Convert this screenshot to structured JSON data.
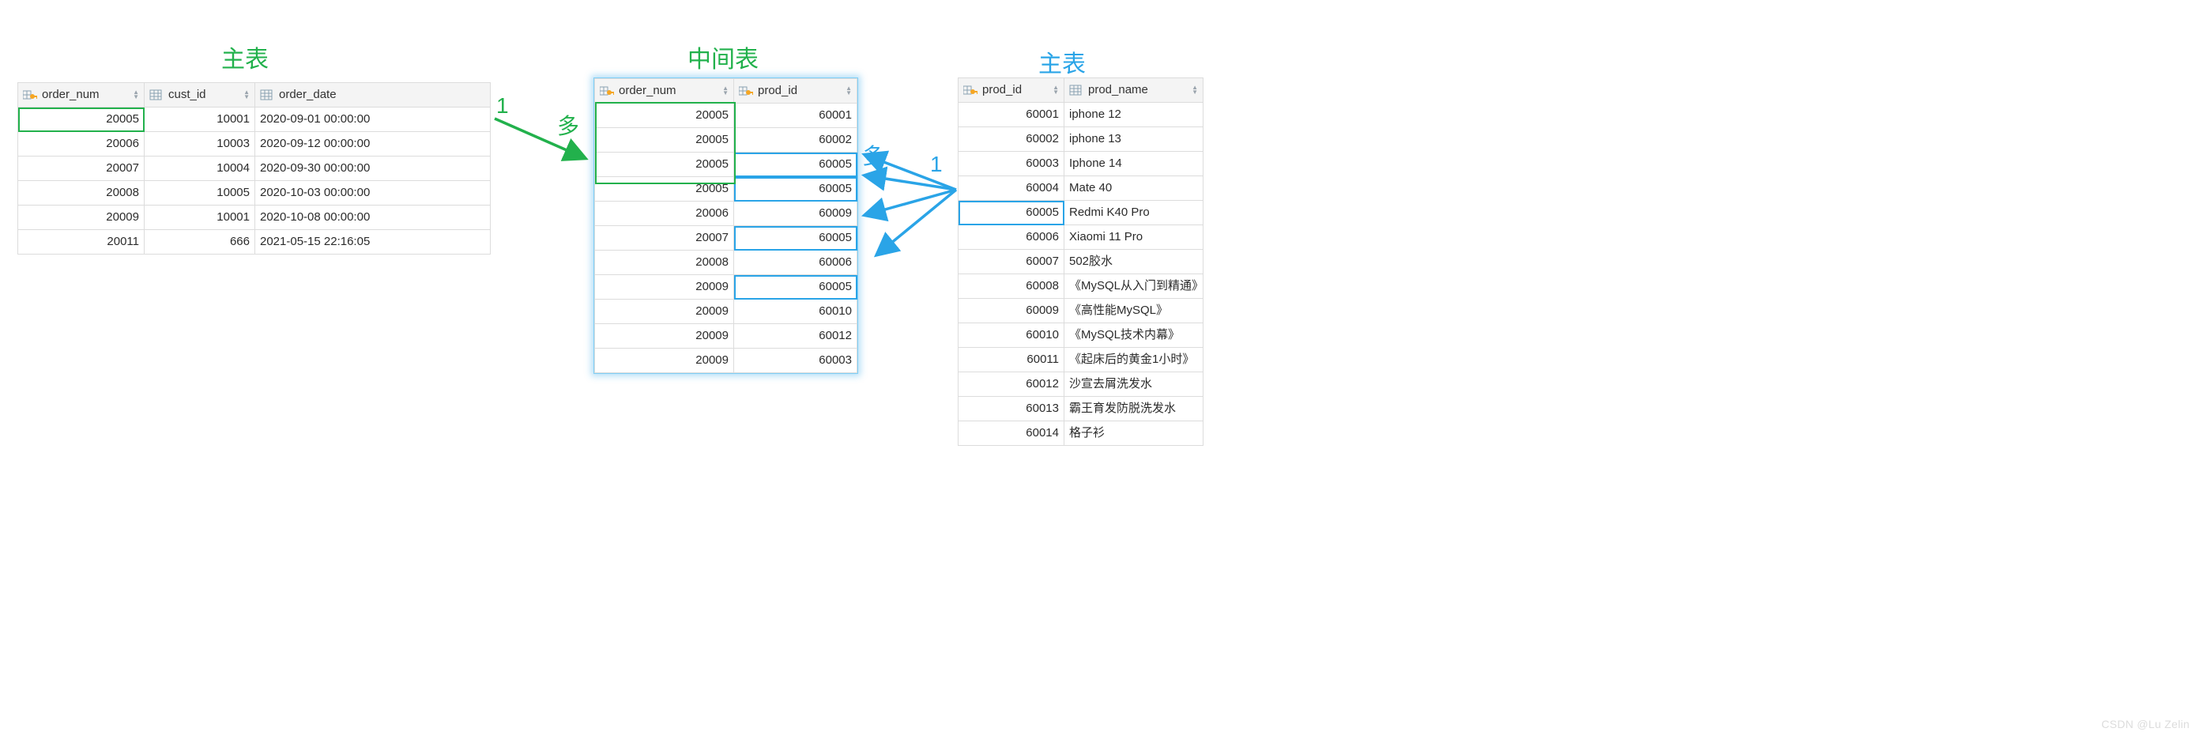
{
  "headings": {
    "left": "主表",
    "middle": "中间表",
    "right": "主表"
  },
  "labels": {
    "one_left": "1",
    "many_left": "多",
    "many_right": "多",
    "one_right": "1"
  },
  "tables": {
    "orders": {
      "cols": [
        {
          "name": "order_num",
          "key": true,
          "align": "num"
        },
        {
          "name": "cust_id",
          "key": false,
          "align": "num"
        },
        {
          "name": "order_date",
          "key": false,
          "align": "txt"
        }
      ],
      "rows": [
        [
          "20005",
          "10001",
          "2020-09-01 00:00:00"
        ],
        [
          "20006",
          "10003",
          "2020-09-12 00:00:00"
        ],
        [
          "20007",
          "10004",
          "2020-09-30 00:00:00"
        ],
        [
          "20008",
          "10005",
          "2020-10-03 00:00:00"
        ],
        [
          "20009",
          "10001",
          "2020-10-08 00:00:00"
        ],
        [
          "20011",
          "666",
          "2021-05-15 22:16:05"
        ]
      ]
    },
    "order_products": {
      "cols": [
        {
          "name": "order_num",
          "key": true,
          "align": "num"
        },
        {
          "name": "prod_id",
          "key": true,
          "align": "num"
        }
      ],
      "rows": [
        [
          "20005",
          "60001"
        ],
        [
          "20005",
          "60002"
        ],
        [
          "20005",
          "60005"
        ],
        [
          "20005",
          "60005"
        ],
        [
          "20006",
          "60009"
        ],
        [
          "20007",
          "60005"
        ],
        [
          "20008",
          "60006"
        ],
        [
          "20009",
          "60005"
        ],
        [
          "20009",
          "60010"
        ],
        [
          "20009",
          "60012"
        ],
        [
          "20009",
          "60003"
        ]
      ]
    },
    "products": {
      "cols": [
        {
          "name": "prod_id",
          "key": true,
          "align": "num"
        },
        {
          "name": "prod_name",
          "key": false,
          "align": "txt"
        }
      ],
      "rows": [
        [
          "60001",
          "iphone 12"
        ],
        [
          "60002",
          "iphone 13"
        ],
        [
          "60003",
          "Iphone 14"
        ],
        [
          "60004",
          "Mate 40"
        ],
        [
          "60005",
          "Redmi K40 Pro"
        ],
        [
          "60006",
          "Xiaomi 11 Pro"
        ],
        [
          "60007",
          "502胶水"
        ],
        [
          "60008",
          "《MySQL从入门到精通》"
        ],
        [
          "60009",
          "《高性能MySQL》"
        ],
        [
          "60010",
          "《MySQL技术内幕》"
        ],
        [
          "60011",
          "《起床后的黄金1小时》"
        ],
        [
          "60012",
          "沙宣去屑洗发水"
        ],
        [
          "60013",
          "霸王育发防脱洗发水"
        ],
        [
          "60014",
          "格子衫"
        ]
      ]
    }
  },
  "watermark": "CSDN @Lu Zelin"
}
